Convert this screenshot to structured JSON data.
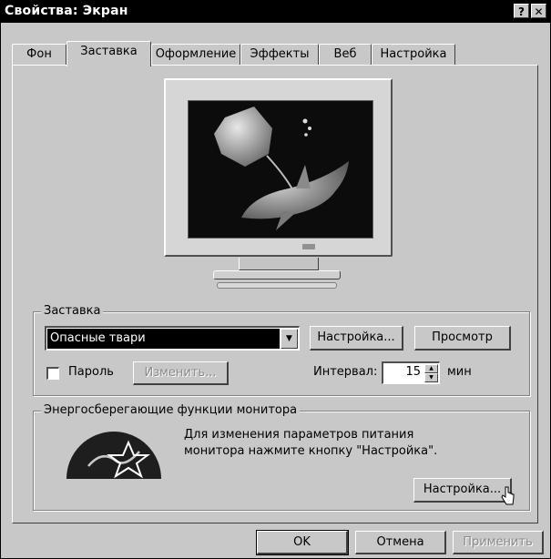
{
  "window": {
    "title": "Свойства: Экран",
    "help": "?",
    "close": "✕"
  },
  "tabs": [
    "Фон",
    "Заставка",
    "Оформление",
    "Эффекты",
    "Веб",
    "Настройка"
  ],
  "active_tab": "Заставка",
  "screensaver_group": {
    "title": "Заставка",
    "selected": "Опасные твари",
    "settings_button": "Настройка...",
    "preview_button": "Просмотр",
    "password_label": "Пароль",
    "password_checked": false,
    "change_button": "Изменить...",
    "interval_label": "Интервал:",
    "interval_value": "15",
    "interval_unit": "мин"
  },
  "energy_group": {
    "title": "Энергосберегающие функции монитора",
    "text_line1": "Для изменения параметров питания",
    "text_line2": "монитора нажмите кнопку \"Настройка\".",
    "settings_button": "Настройка..."
  },
  "footer": {
    "ok": "OK",
    "cancel": "Отмена",
    "apply": "Применить"
  },
  "colors": {
    "face": "#c8c8c8",
    "selection": "#000000",
    "titlebar": "#000000"
  }
}
